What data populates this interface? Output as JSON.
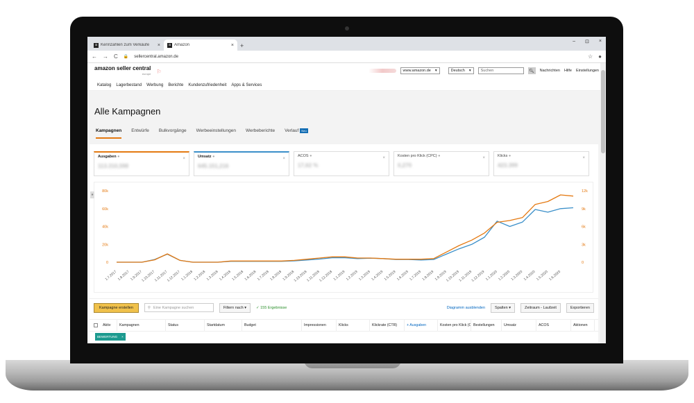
{
  "browser": {
    "tabs": [
      {
        "favicon": "a",
        "label": "Kennzahlen zum Verkäufe",
        "active": false
      },
      {
        "favicon": "a",
        "label": "Amazon",
        "active": true
      }
    ],
    "new_tab": "+",
    "window_controls": [
      "–",
      "⊡",
      "×"
    ],
    "nav": [
      "←",
      "→",
      "C"
    ],
    "url": "sellercentral.amazon.de",
    "star": "☆",
    "profile": "●"
  },
  "header": {
    "logo": "amazon seller central",
    "logo_sub": "europe",
    "flag": "⚐",
    "marketplace": "www.amazon.de",
    "language": "Deutsch",
    "search_placeholder": "Suchen",
    "links": [
      "Nachrichten",
      "Hilfe",
      "Einstellungen"
    ]
  },
  "nav": [
    "Katalog",
    "Lagerbestand",
    "Werbung",
    "Berichte",
    "Kundenzufriedenheit",
    "Apps & Services"
  ],
  "page": {
    "title": "Alle Kampagnen",
    "tabs": [
      "Kampagnen",
      "Entwürfe",
      "Bulkvorgänge",
      "Werbeeinstellungen",
      "Werbeberichte",
      "Verlauf"
    ],
    "new_badge": "Neu"
  },
  "metrics": [
    {
      "label": "Ausgaben",
      "value": "113.310,598",
      "color": "#e47911"
    },
    {
      "label": "Umsatz",
      "value": "645.151,216",
      "color": "#3a8fc9"
    },
    {
      "label": "ACOS",
      "value": "17,62 %",
      "color": ""
    },
    {
      "label": "Kosten pro Klick (CPC)",
      "value": "0,270",
      "color": ""
    },
    {
      "label": "Klicks",
      "value": "423.399",
      "color": ""
    }
  ],
  "chart_data": {
    "type": "line",
    "x": [
      "1.7.2017",
      "1.8.2017",
      "1.9.2017",
      "1.10.2017",
      "1.11.2017",
      "1.12.2017",
      "1.1.2018",
      "1.2.2018",
      "1.3.2018",
      "1.4.2018",
      "1.5.2018",
      "1.6.2018",
      "1.7.2018",
      "1.8.2018",
      "1.9.2018",
      "1.10.2018",
      "1.11.2018",
      "1.12.2018",
      "1.1.2019",
      "1.2.2019",
      "1.3.2019",
      "1.4.2019",
      "1.5.2019",
      "1.6.2019",
      "1.7.2019",
      "1.8.2019",
      "1.9.2019",
      "1.10.2019",
      "1.11.2019",
      "1.12.2019",
      "1.1.2020",
      "1.2.2020",
      "1.3.2020",
      "1.4.2020",
      "1.5.2020",
      "1.6.2020"
    ],
    "series": [
      {
        "name": "Umsatz",
        "axis": "left",
        "color": "#3a8fc9",
        "values": [
          0,
          0,
          0,
          3000,
          9000,
          2000,
          0,
          0,
          0,
          1000,
          1000,
          1000,
          1000,
          1000,
          1500,
          2500,
          3500,
          5000,
          5000,
          4000,
          4500,
          4000,
          3000,
          3000,
          2500,
          3000,
          9000,
          15000,
          20000,
          28000,
          46000,
          40000,
          45000,
          59000,
          56000,
          60000,
          61000
        ]
      },
      {
        "name": "Ausgaben",
        "axis": "right",
        "color": "#e47911",
        "values": [
          0,
          0,
          0,
          400,
          1400,
          300,
          0,
          0,
          0,
          200,
          200,
          200,
          200,
          200,
          300,
          500,
          700,
          900,
          900,
          700,
          700,
          600,
          500,
          500,
          500,
          600,
          1700,
          2800,
          3700,
          4900,
          6700,
          7000,
          7500,
          9700,
          10200,
          11300,
          11100
        ]
      }
    ],
    "yleft_ticks": [
      "0",
      "20k",
      "40k",
      "60k",
      "80k"
    ],
    "yright_ticks": [
      "0",
      "3k",
      "6k",
      "9k",
      "12k"
    ],
    "yleft_lim": [
      0,
      80000
    ],
    "yright_lim": [
      0,
      12000
    ],
    "grid": false
  },
  "toolbar": {
    "create": "Kampagne erstellen",
    "search_placeholder": "Eine Kampagne suchen",
    "filter": "Filtern nach",
    "results": "155 Ergebnisse",
    "hide_chart": "Diagramm ausblenden",
    "columns": "Spalten",
    "period": "Zeitraum - Laufzeit",
    "export": "Exportieren"
  },
  "table": {
    "headers": [
      "Aktiv",
      "Kampagnen",
      "Status",
      "Startdatum",
      "Budget",
      "Impressionen",
      "Klicks",
      "Klickrate (CTR)",
      "+ Ausgaben",
      "Kosten pro Klick (CPC)",
      "Bestellungen",
      "Umsatz",
      "ACOS",
      "Aktionen"
    ]
  },
  "filter_chip": {
    "label": "BEWERTUNG",
    "close": "×"
  }
}
